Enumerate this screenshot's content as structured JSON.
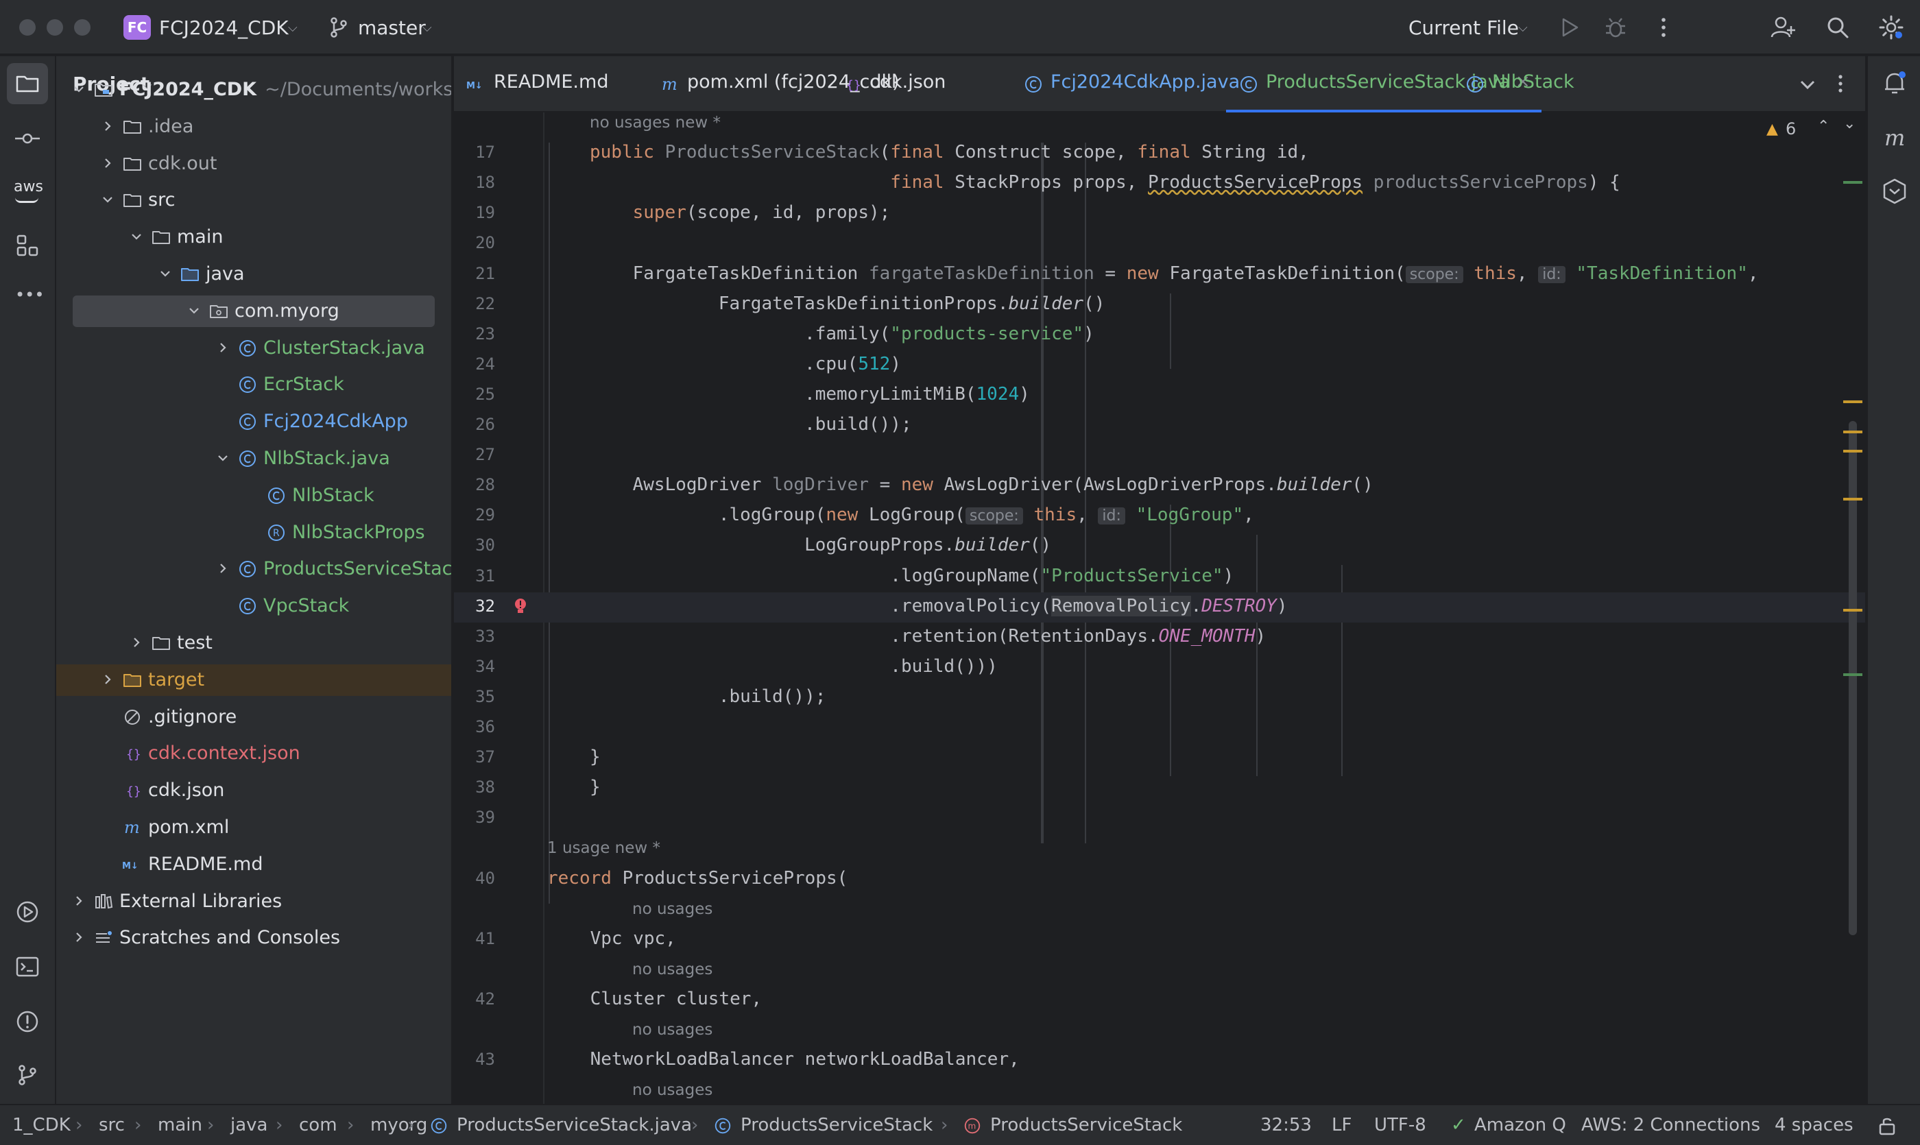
{
  "titlebar": {
    "project_badge": "FC",
    "project_name": "FCJ2024_CDK",
    "branch": "master",
    "run_config": "Current File"
  },
  "colors": {
    "accent": "#3574f0",
    "keyword": "#cf8e6d",
    "string": "#6aab73",
    "number": "#2aacb8",
    "constant": "#c77dbb",
    "vcs_added": "#73bd79",
    "vcs_unversioned": "#e16d74",
    "excluded": "#d9a343"
  },
  "toolstrip": {
    "top": [
      "folder-icon",
      "commit-icon",
      "aws-icon",
      "structure-icon",
      "more-icon"
    ],
    "bottom": [
      "services-icon",
      "terminal-icon",
      "problems-icon",
      "git-icon"
    ],
    "aws_label": "aws",
    "more_label": "•••"
  },
  "project_panel": {
    "title": "Project",
    "tree": [
      {
        "label": "FCJ2024_CDK",
        "sub": "~/Documents/workshop",
        "depth": 0,
        "expanded": true,
        "icon": "module",
        "color": "bold"
      },
      {
        "label": ".idea",
        "depth": 1,
        "expanded": false,
        "icon": "folder",
        "color": "grey"
      },
      {
        "label": "cdk.out",
        "depth": 1,
        "expanded": false,
        "icon": "folder",
        "color": "grey"
      },
      {
        "label": "src",
        "depth": 1,
        "expanded": true,
        "icon": "folder",
        "color": ""
      },
      {
        "label": "main",
        "depth": 2,
        "expanded": true,
        "icon": "folder",
        "color": ""
      },
      {
        "label": "java",
        "depth": 3,
        "expanded": true,
        "icon": "src-folder",
        "color": ""
      },
      {
        "label": "com.myorg",
        "depth": 4,
        "expanded": true,
        "icon": "package",
        "color": "",
        "selected": true
      },
      {
        "label": "ClusterStack.java",
        "depth": 5,
        "expanded": false,
        "icon": "class",
        "color": "green"
      },
      {
        "label": "EcrStack",
        "depth": 5,
        "icon": "class",
        "color": "green"
      },
      {
        "label": "Fcj2024CdkApp",
        "depth": 5,
        "icon": "class",
        "color": "blue"
      },
      {
        "label": "NlbStack.java",
        "depth": 5,
        "expanded": true,
        "icon": "class",
        "color": "green"
      },
      {
        "label": "NlbStack",
        "depth": 6,
        "icon": "class",
        "color": "green"
      },
      {
        "label": "NlbStackProps",
        "depth": 6,
        "icon": "record",
        "color": "green"
      },
      {
        "label": "ProductsServiceStack.java",
        "depth": 5,
        "expanded": false,
        "icon": "class",
        "color": "green"
      },
      {
        "label": "VpcStack",
        "depth": 5,
        "icon": "class",
        "color": "green"
      },
      {
        "label": "test",
        "depth": 2,
        "expanded": false,
        "icon": "folder",
        "color": ""
      },
      {
        "label": "target",
        "depth": 1,
        "expanded": false,
        "icon": "folder-excluded",
        "color": "orange",
        "excluded": true
      },
      {
        "label": ".gitignore",
        "depth": 1,
        "icon": "ignore",
        "color": ""
      },
      {
        "label": "cdk.context.json",
        "depth": 1,
        "icon": "json",
        "color": "red"
      },
      {
        "label": "cdk.json",
        "depth": 1,
        "icon": "json",
        "color": ""
      },
      {
        "label": "pom.xml",
        "depth": 1,
        "icon": "maven",
        "color": ""
      },
      {
        "label": "README.md",
        "depth": 1,
        "icon": "markdown",
        "color": ""
      },
      {
        "label": "External Libraries",
        "depth": 0,
        "expanded": false,
        "icon": "library",
        "color": ""
      },
      {
        "label": "Scratches and Consoles",
        "depth": 0,
        "expanded": false,
        "icon": "scratches",
        "color": ""
      }
    ]
  },
  "tabs": [
    {
      "label": "README.md",
      "icon": "markdown",
      "color": ""
    },
    {
      "label": "pom.xml (fcj2024_cdk)",
      "icon": "maven",
      "color": ""
    },
    {
      "label": "cdk.json",
      "icon": "json",
      "color": ""
    },
    {
      "label": "Fcj2024CdkApp.java",
      "icon": "class",
      "color": "blue"
    },
    {
      "label": "ProductsServiceStack.java",
      "icon": "class",
      "color": "green",
      "active": true
    },
    {
      "label": "NlbStack",
      "icon": "class",
      "color": "green"
    }
  ],
  "tab_close": "×",
  "editor": {
    "warning_count": "6",
    "rows": [
      {
        "hint": "no usages   new *"
      },
      {
        "ln": "17",
        "html": "<span class=\"kw\">public</span> <span class=\"grey\">ProductsServiceStack</span>(<span class=\"kw\">final</span> Construct scope, <span class=\"kw\">final</span> String id,"
      },
      {
        "ln": "18",
        "html": "                            <span class=\"kw\">final</span> StackProps props, <span class=\"warnul\">ProductsServiceProps</span> <span class=\"grey\">productsServiceProps</span>) {"
      },
      {
        "ln": "19",
        "html": "    <span class=\"kw\">super</span>(scope, id, props);"
      },
      {
        "ln": "20",
        "html": ""
      },
      {
        "ln": "21",
        "html": "    FargateTaskDefinition <span class=\"grey\">fargateTaskDefinition</span> = <span class=\"kw\">new</span> FargateTaskDefinition(<span class=\"inlay\">scope:</span> <span class=\"kw\">this</span>, <span class=\"inlay\">id:</span> <span class=\"str\">\"TaskDefinition\"</span>,"
      },
      {
        "ln": "22",
        "html": "            FargateTaskDefinitionProps.<span class=\"ital\">builder</span>()"
      },
      {
        "ln": "23",
        "html": "                    .family(<span class=\"str\">\"products-service\"</span>)"
      },
      {
        "ln": "24",
        "html": "                    .cpu(<span class=\"num\">512</span>)"
      },
      {
        "ln": "25",
        "html": "                    .memoryLimitMiB(<span class=\"num\">1024</span>)"
      },
      {
        "ln": "26",
        "html": "                    .build());"
      },
      {
        "ln": "27",
        "html": ""
      },
      {
        "ln": "28",
        "html": "    AwsLogDriver <span class=\"grey\">logDriver</span> = <span class=\"kw\">new</span> AwsLogDriver(AwsLogDriverProps.<span class=\"ital\">builder</span>()"
      },
      {
        "ln": "29",
        "html": "            .logGroup(<span class=\"kw\">new</span> LogGroup(<span class=\"inlay\">scope:</span> <span class=\"kw\">this</span>, <span class=\"inlay\">id:</span> <span class=\"str\">\"LogGroup\"</span>,"
      },
      {
        "ln": "30",
        "html": "                    LogGroupProps.<span class=\"ital\">builder</span>()"
      },
      {
        "ln": "31",
        "html": "                            .logGroupName(<span class=\"str\">\"ProductsService\"</span>)"
      },
      {
        "ln": "32",
        "html": "                            .removalPolicy(<span class=\"hl-ident\">RemovalPolicy</span>.<span class=\"const\">DESTROY</span>)",
        "current": true,
        "bulb": true
      },
      {
        "ln": "33",
        "html": "                            .retention(RetentionDays.<span class=\"const\">ONE_MONTH</span>)"
      },
      {
        "ln": "34",
        "html": "                            .build()))"
      },
      {
        "ln": "35",
        "html": "            .build());"
      },
      {
        "ln": "36",
        "html": ""
      },
      {
        "ln": "37",
        "html": "}"
      },
      {
        "ln": "38",
        "html": "}"
      },
      {
        "ln": "39",
        "html": ""
      },
      {
        "hint": "1 usage   new *",
        "outer": true
      },
      {
        "ln": "40",
        "html": "<span class=\"kw\">record</span> ProductsServiceProps(",
        "outer": true
      },
      {
        "hint": "no usages",
        "inner": true
      },
      {
        "ln": "41",
        "html": "    Vpc vpc,",
        "outer": true
      },
      {
        "hint": "no usages",
        "inner": true
      },
      {
        "ln": "42",
        "html": "    Cluster cluster,",
        "outer": true
      },
      {
        "hint": "no usages",
        "inner": true
      },
      {
        "ln": "43",
        "html": "    NetworkLoadBalancer networkLoadBalancer,",
        "outer": true
      },
      {
        "hint": "no usages",
        "inner": true
      }
    ]
  },
  "statusbar": {
    "breadcrumbs": [
      "1_CDK",
      "src",
      "main",
      "java",
      "com",
      "myorg",
      "ProductsServiceStack.java",
      "ProductsServiceStack",
      "ProductsServiceStack"
    ],
    "position": "32:53",
    "line_sep": "LF",
    "encoding": "UTF-8",
    "amazon_q": "Amazon Q",
    "aws": "AWS: 2 Connections",
    "indent": "4 spaces"
  }
}
